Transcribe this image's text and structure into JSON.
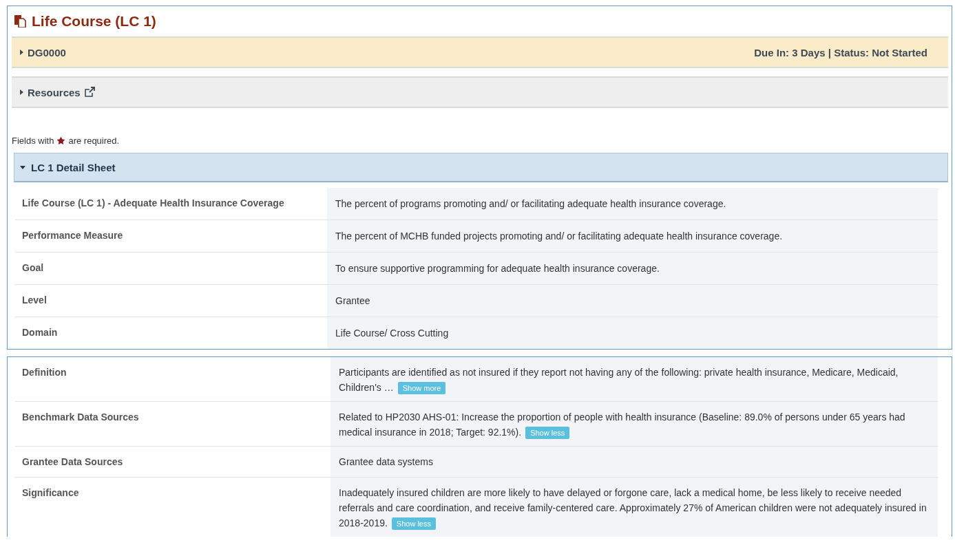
{
  "page_title": "Life Course (LC 1)",
  "submission_bar": {
    "label": "DG0000",
    "expanded": false,
    "status": "Due In: 3 Days | Status: Not Started"
  },
  "resources_bar": {
    "label": "Resources",
    "expanded": false
  },
  "required_note": {
    "before": "Fields with",
    "after": "are required."
  },
  "detail_sheet": {
    "title": "LC 1 Detail Sheet",
    "expanded": true
  },
  "panels": [
    {
      "rows": [
        {
          "label": "Life Course (LC 1) - Adequate Health Insurance Coverage",
          "value": "The percent of programs promoting and/ or facilitating adequate health insurance coverage."
        },
        {
          "label": "Performance Measure",
          "value": "The percent of MCHB funded projects promoting and/ or facilitating adequate health insurance coverage."
        },
        {
          "label": "Goal",
          "value": "To ensure supportive programming for adequate health insurance coverage."
        },
        {
          "label": "Level",
          "value": "Grantee"
        },
        {
          "label": "Domain",
          "value": "Life Course/ Cross Cutting"
        }
      ]
    },
    {
      "rows": [
        {
          "label": "Definition",
          "value": "Participants are identified as not insured if they report not having any of the following: private health insurance, Medicare, Medicaid, Children's …",
          "toggle": "Show more"
        },
        {
          "label": "Benchmark Data Sources",
          "value": "Related to HP2030 AHS-01: Increase the proportion of people with health insurance (Baseline: 89.0% of persons under 65 years had medical insurance in 2018; Target: 92.1%).",
          "toggle": "Show less"
        },
        {
          "label": "Grantee Data Sources",
          "value": "Grantee data systems"
        },
        {
          "label": "Significance",
          "value": "Inadequately insured children are more likely to have delayed or forgone care, lack a medical home, be less likely to receive needed referrals and care coordination, and receive family-centered care. Approximately 27% of American children were not adequately insured in 2018-2019.",
          "toggle": "Show less"
        }
      ]
    }
  ]
}
